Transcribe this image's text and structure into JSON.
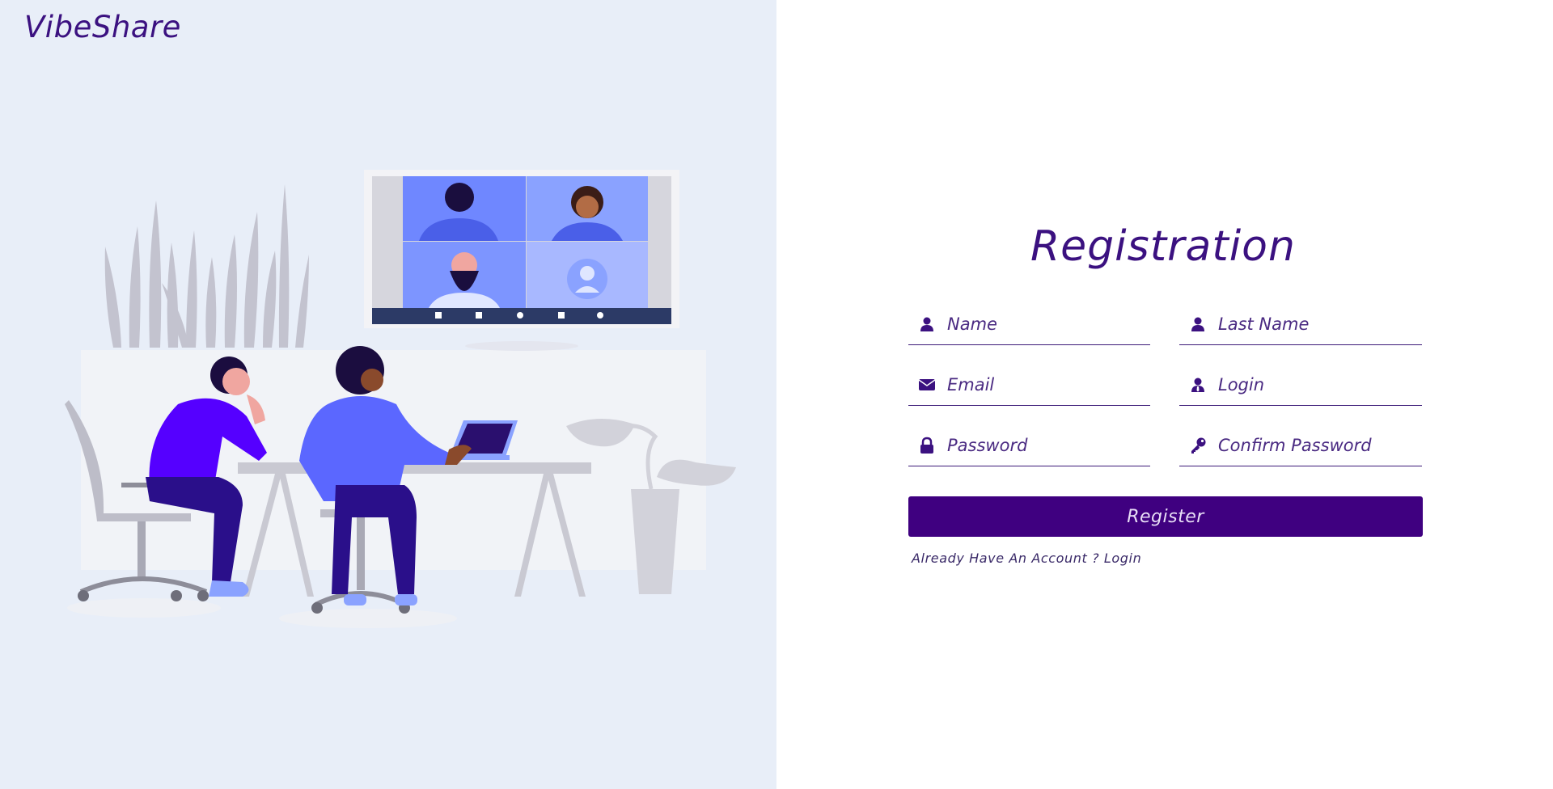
{
  "brand": {
    "name": "VibeShare"
  },
  "form": {
    "title": "Registration",
    "fields": {
      "name": {
        "placeholder": "Name",
        "icon": "user-icon"
      },
      "last_name": {
        "placeholder": "Last Name",
        "icon": "user-icon"
      },
      "email": {
        "placeholder": "Email",
        "icon": "envelope-icon"
      },
      "login": {
        "placeholder": "Login",
        "icon": "user-tie-icon"
      },
      "password": {
        "placeholder": "Password",
        "icon": "lock-icon"
      },
      "confirm_password": {
        "placeholder": "Confirm Password",
        "icon": "key-icon"
      }
    },
    "register_label": "Register",
    "login_link": "Already Have An Account ? Login"
  },
  "colors": {
    "accent": "#3f0080",
    "brand_text": "#3b1180",
    "left_panel_bg": "#e8eef8"
  }
}
